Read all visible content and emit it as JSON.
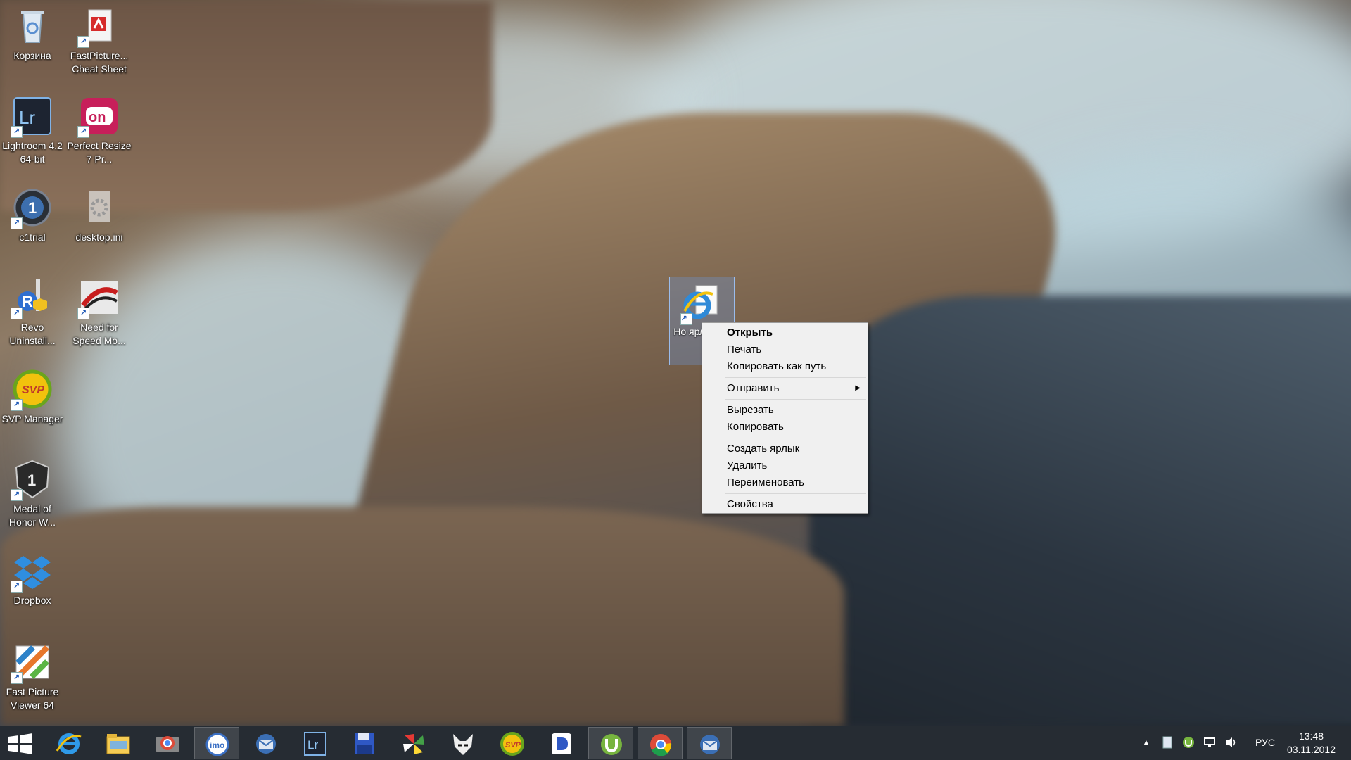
{
  "desktop": {
    "icons": [
      {
        "label": "Корзина",
        "icon": "recycle-bin-icon"
      },
      {
        "label": "FastPicture... Cheat Sheet",
        "icon": "pdf-document-icon"
      },
      {
        "label": "Lightroom 4.2 64-bit",
        "icon": "lightroom-icon"
      },
      {
        "label": "Perfect Resize 7 Pr...",
        "icon": "perfect-resize-icon"
      },
      {
        "label": "c1trial",
        "icon": "capture-one-icon"
      },
      {
        "label": "desktop.ini",
        "icon": "settings-file-icon"
      },
      {
        "label": "Revo Uninstall...",
        "icon": "revo-uninstaller-icon"
      },
      {
        "label": "Need for Speed Mo...",
        "icon": "need-for-speed-icon"
      },
      {
        "label": "SVP Manager",
        "icon": "svp-icon"
      },
      {
        "label": "Medal of Honor W...",
        "icon": "medal-of-honor-icon"
      },
      {
        "label": "Dropbox",
        "icon": "dropbox-icon"
      },
      {
        "label": "Fast Picture Viewer 64",
        "icon": "fast-picture-viewer-icon"
      }
    ],
    "selected_icon": {
      "label": "Но ярл Инте",
      "icon": "internet-explorer-icon"
    }
  },
  "context_menu": {
    "items": [
      {
        "label": "Открыть",
        "bold": true
      },
      {
        "label": "Печать"
      },
      {
        "label": "Копировать как путь"
      },
      {
        "label": "Отправить",
        "submenu": true
      },
      {
        "label": "Вырезать"
      },
      {
        "label": "Копировать"
      },
      {
        "label": "Создать ярлык"
      },
      {
        "label": "Удалить"
      },
      {
        "label": "Переименовать"
      },
      {
        "label": "Свойства"
      }
    ]
  },
  "taskbar": {
    "start_icon": "windows-start-icon",
    "apps": [
      {
        "icon": "internet-explorer-icon"
      },
      {
        "icon": "file-explorer-icon"
      },
      {
        "icon": "chrome-remote-icon"
      },
      {
        "icon": "imo-messenger-icon"
      },
      {
        "icon": "thunderbird-icon"
      },
      {
        "icon": "lightroom-icon"
      },
      {
        "icon": "save-disk-icon"
      },
      {
        "icon": "pinwheel-app-icon"
      },
      {
        "icon": "foobar-fox-icon"
      },
      {
        "icon": "svp-icon"
      },
      {
        "icon": "daemon-tools-icon"
      },
      {
        "icon": "utorrent-icon"
      },
      {
        "icon": "chrome-icon"
      },
      {
        "icon": "thunderbird-icon"
      }
    ],
    "tray": {
      "icons": [
        "show-hidden-icons-arrow-icon",
        "document-icon",
        "utorrent-tray-icon",
        "network-icon",
        "volume-icon"
      ],
      "language": "РУС",
      "time": "13:48",
      "date": "03.11.2012"
    }
  },
  "colors": {
    "accent": "#3a7bd5",
    "taskbar": "#141a22",
    "menu_bg": "#f0f0f0"
  }
}
